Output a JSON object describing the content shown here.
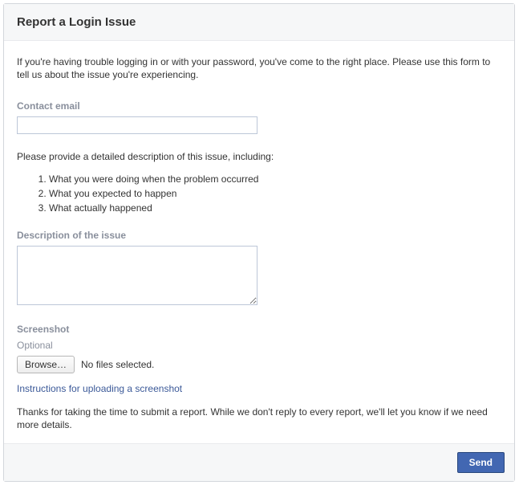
{
  "header": {
    "title": "Report a Login Issue"
  },
  "intro": "If you're having trouble logging in or with your password, you've come to the right place. Please use this form to tell us about the issue you're experiencing.",
  "contact": {
    "label": "Contact email",
    "value": ""
  },
  "description_help": {
    "lead": "Please provide a detailed description of this issue, including:",
    "items": [
      "What you were doing when the problem occurred",
      "What you expected to happen",
      "What actually happened"
    ]
  },
  "description": {
    "label": "Description of the issue",
    "value": ""
  },
  "screenshot": {
    "label": "Screenshot",
    "optional": "Optional",
    "browse_label": "Browse…",
    "no_files": "No files selected.",
    "instructions_link": "Instructions for uploading a screenshot"
  },
  "thanks": "Thanks for taking the time to submit a report. While we don't reply to every report, we'll let you know if we need more details.",
  "footer": {
    "send_label": "Send"
  }
}
